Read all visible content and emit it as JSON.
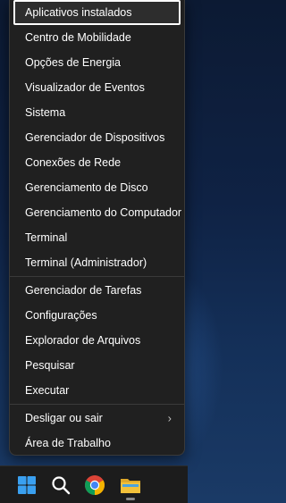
{
  "menu": {
    "group1": [
      {
        "label": "Aplicativos instalados",
        "highlighted": true
      },
      {
        "label": "Centro de Mobilidade"
      },
      {
        "label": "Opções de Energia"
      },
      {
        "label": "Visualizador de Eventos"
      },
      {
        "label": "Sistema"
      },
      {
        "label": "Gerenciador de Dispositivos"
      },
      {
        "label": "Conexões de Rede"
      },
      {
        "label": "Gerenciamento de Disco"
      },
      {
        "label": "Gerenciamento do Computador"
      },
      {
        "label": "Terminal"
      },
      {
        "label": "Terminal (Administrador)"
      }
    ],
    "group2": [
      {
        "label": "Gerenciador de Tarefas"
      },
      {
        "label": "Configurações"
      },
      {
        "label": "Explorador de Arquivos"
      },
      {
        "label": "Pesquisar"
      },
      {
        "label": "Executar"
      }
    ],
    "group3": [
      {
        "label": "Desligar ou sair",
        "submenu_glyph": "›"
      },
      {
        "label": "Área de Trabalho"
      }
    ]
  },
  "taskbar": {
    "icons": [
      "windows-start-icon",
      "search-icon",
      "chrome-icon",
      "file-explorer-icon"
    ],
    "colors": {
      "windows_blue": "#3aa0f0",
      "chrome_red": "#db4437",
      "chrome_yellow": "#f4b400",
      "chrome_green": "#0f9d58",
      "chrome_blue": "#4285f4",
      "folder_yellow": "#f3c13a"
    }
  }
}
